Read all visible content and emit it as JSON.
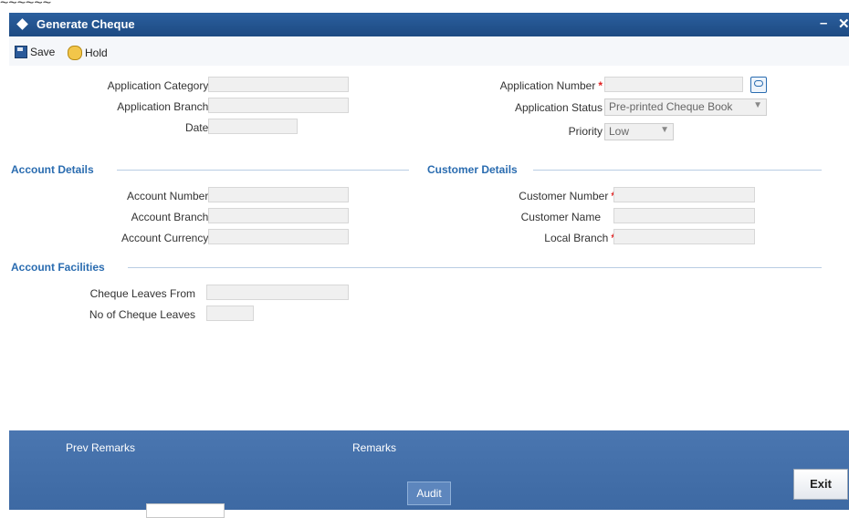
{
  "window": {
    "title": "Generate Cheque",
    "minimize": "–",
    "close": "✕"
  },
  "toolbar": {
    "save_label": "Save",
    "hold_label": "Hold"
  },
  "form": {
    "application_category": {
      "label": "Application Category",
      "value": ""
    },
    "application_branch": {
      "label": "Application Branch",
      "value": ""
    },
    "date": {
      "label": "Date",
      "value": ""
    },
    "application_number": {
      "label": "Application Number",
      "value": ""
    },
    "application_status": {
      "label": "Application Status",
      "value": "Pre-printed Cheque Book"
    },
    "priority": {
      "label": "Priority",
      "value": "Low"
    }
  },
  "account_details": {
    "title": "Account Details",
    "account_number": {
      "label": "Account Number",
      "value": ""
    },
    "account_branch": {
      "label": "Account Branch",
      "value": ""
    },
    "account_currency": {
      "label": "Account Currency",
      "value": ""
    }
  },
  "customer_details": {
    "title": "Customer Details",
    "customer_number": {
      "label": "Customer Number",
      "value": ""
    },
    "customer_name": {
      "label": "Customer Name",
      "value": ""
    },
    "local_branch": {
      "label": "Local Branch",
      "value": ""
    }
  },
  "account_facilities": {
    "title": "Account Facilities",
    "cheque_leaves_from": {
      "label": "Cheque Leaves From",
      "value": ""
    },
    "no_of_cheque_leaves": {
      "label": "No of Cheque Leaves",
      "value": ""
    }
  },
  "footer": {
    "prev_remarks": "Prev Remarks",
    "remarks": "Remarks",
    "audit": "Audit",
    "exit": "Exit"
  },
  "required_marker": "*",
  "colors": {
    "title_bar": "#1d4a82",
    "section_title": "#2a6cb0",
    "required": "#e02020",
    "footer": "#3d69a3"
  }
}
